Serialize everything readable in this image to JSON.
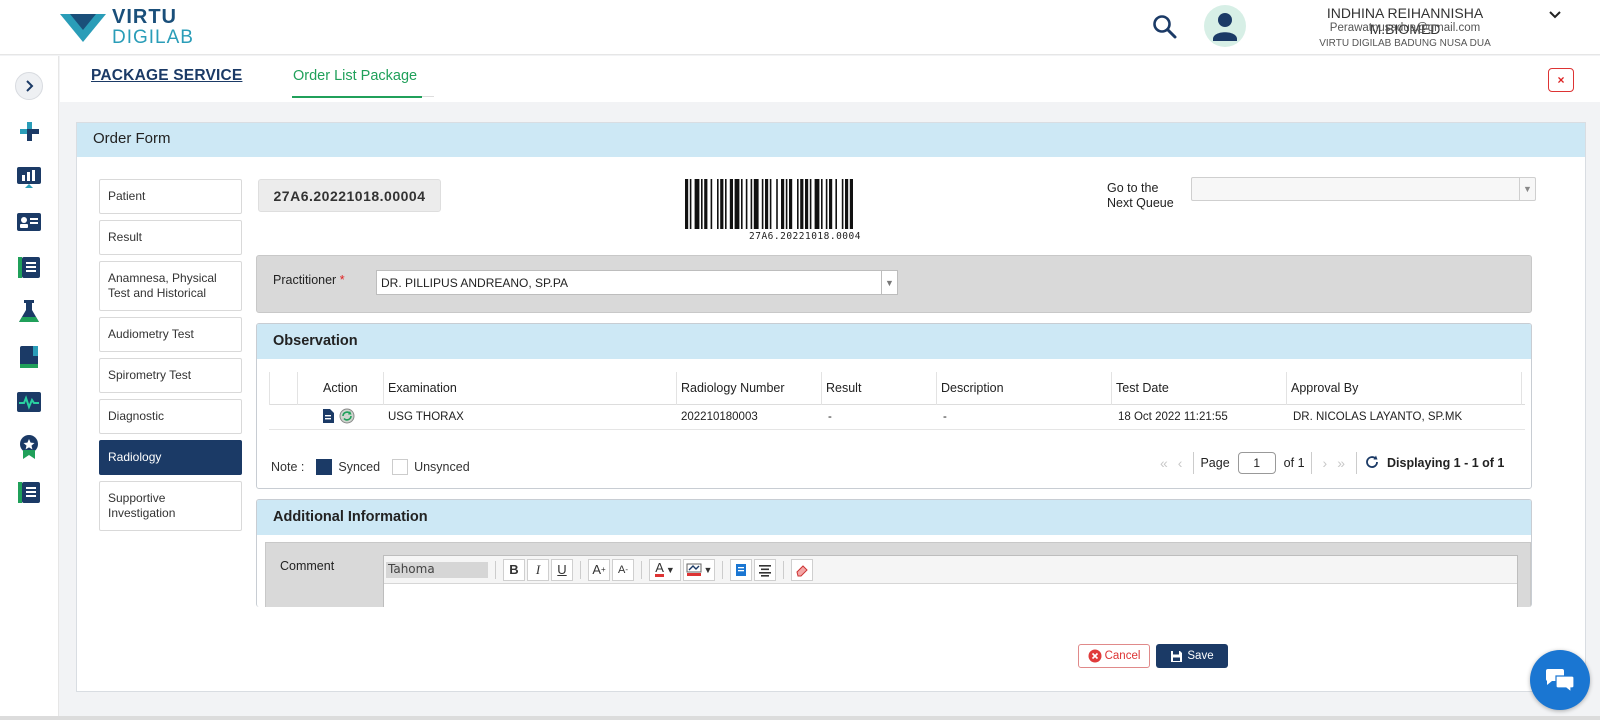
{
  "brand": {
    "line1": "VIRTU",
    "line2": "DIGILAB"
  },
  "user": {
    "name": "INDHINA REIHANNISHA M.BIOMED",
    "email": "Perawatnusadua@gmail.com",
    "org": "VIRTU DIGILAB BADUNG NUSA DUA"
  },
  "tabs": {
    "package_service": "PACKAGE SERVICE",
    "order_list": "Order List Package",
    "close": "×"
  },
  "panel": {
    "title": "Order Form"
  },
  "menu": [
    {
      "label": "Patient"
    },
    {
      "label": "Result"
    },
    {
      "label": "Anamnesa, Physical Test and Historical"
    },
    {
      "label": "Audiometry Test"
    },
    {
      "label": "Spirometry Test"
    },
    {
      "label": "Diagnostic"
    },
    {
      "label": "Radiology",
      "active": true
    },
    {
      "label": "Supportive Investigation"
    }
  ],
  "order": {
    "number": "27A6.20221018.00004",
    "barcode_text": "27A6.20221018.0004",
    "next_queue_label": "Go to the Next Queue",
    "next_queue_value": ""
  },
  "practitioner": {
    "label": "Practitioner",
    "required": "*",
    "value": "DR. PILLIPUS ANDREANO, SP.PA"
  },
  "observation": {
    "title": "Observation",
    "columns": [
      "Action",
      "Examination",
      "Radiology Number",
      "Result",
      "Description",
      "Test Date",
      "Approval By"
    ],
    "rows": [
      {
        "examination": "USG THORAX",
        "radiology_number": "202210180003",
        "result": "-",
        "description": "-",
        "test_date": "18 Oct 2022 11:21:55",
        "approval_by": "DR. NICOLAS LAYANTO, SP.MK"
      }
    ],
    "note_label": "Note :",
    "synced_label": "Synced",
    "unsynced_label": "Unsynced",
    "synced_color": "#1b3a66",
    "pager": {
      "page_label": "Page",
      "page": "1",
      "of_label": "of 1",
      "display": "Displaying 1 - 1 of 1"
    }
  },
  "additional": {
    "title": "Additional Information",
    "comment_label": "Comment",
    "font": "Tahoma"
  },
  "actions": {
    "cancel": "Cancel",
    "save": "Save"
  },
  "colors": {
    "primary": "#1b3a66",
    "accent_green": "#20a05a",
    "header_blue": "#cde8f5",
    "danger": "#dd3333"
  }
}
